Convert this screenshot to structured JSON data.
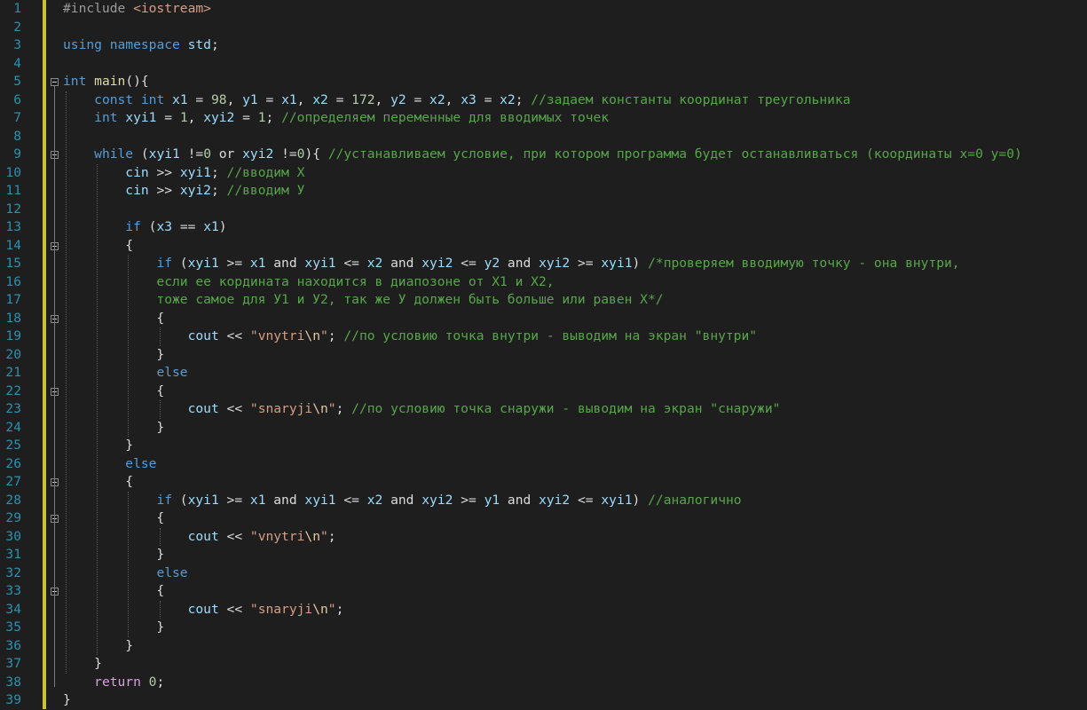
{
  "lines": [
    [
      [
        "p",
        "#include "
      ],
      [
        "s",
        "<iostream>"
      ]
    ],
    [],
    [
      [
        "k",
        "using"
      ],
      [
        "t",
        " "
      ],
      [
        "k",
        "namespace"
      ],
      [
        "t",
        " "
      ],
      [
        "v",
        "std"
      ],
      [
        "t",
        ";"
      ]
    ],
    [],
    [
      [
        "ty",
        "int"
      ],
      [
        "t",
        " "
      ],
      [
        "fn",
        "main"
      ],
      [
        "t",
        "(){"
      ]
    ],
    [
      [
        "t",
        "    "
      ],
      [
        "k",
        "const"
      ],
      [
        "t",
        " "
      ],
      [
        "ty",
        "int"
      ],
      [
        "t",
        " "
      ],
      [
        "v",
        "x1"
      ],
      [
        "t",
        " = "
      ],
      [
        "n",
        "98"
      ],
      [
        "t",
        ", "
      ],
      [
        "v",
        "y1"
      ],
      [
        "t",
        " = "
      ],
      [
        "v",
        "x1"
      ],
      [
        "t",
        ", "
      ],
      [
        "v",
        "x2"
      ],
      [
        "t",
        " = "
      ],
      [
        "n",
        "172"
      ],
      [
        "t",
        ", "
      ],
      [
        "v",
        "y2"
      ],
      [
        "t",
        " = "
      ],
      [
        "v",
        "x2"
      ],
      [
        "t",
        ", "
      ],
      [
        "v",
        "x3"
      ],
      [
        "t",
        " = "
      ],
      [
        "v",
        "x2"
      ],
      [
        "t",
        "; "
      ],
      [
        "c",
        "//задаем константы координат треугольника"
      ]
    ],
    [
      [
        "t",
        "    "
      ],
      [
        "ty",
        "int"
      ],
      [
        "t",
        " "
      ],
      [
        "v",
        "xyi1"
      ],
      [
        "t",
        " = "
      ],
      [
        "n",
        "1"
      ],
      [
        "t",
        ", "
      ],
      [
        "v",
        "xyi2"
      ],
      [
        "t",
        " = "
      ],
      [
        "n",
        "1"
      ],
      [
        "t",
        "; "
      ],
      [
        "c",
        "//определяем переменные для вводимых точек"
      ]
    ],
    [],
    [
      [
        "t",
        "    "
      ],
      [
        "k",
        "while"
      ],
      [
        "t",
        " ("
      ],
      [
        "v",
        "xyi1"
      ],
      [
        "t",
        " !="
      ],
      [
        "n",
        "0"
      ],
      [
        "t",
        " or "
      ],
      [
        "v",
        "xyi2"
      ],
      [
        "t",
        " !="
      ],
      [
        "n",
        "0"
      ],
      [
        "t",
        "){ "
      ],
      [
        "c",
        "//устанавливаем условие, при котором программа будет останавливаться (координаты x=0 y=0)"
      ]
    ],
    [
      [
        "t",
        "        "
      ],
      [
        "v",
        "cin"
      ],
      [
        "t",
        " >> "
      ],
      [
        "v",
        "xyi1"
      ],
      [
        "t",
        "; "
      ],
      [
        "c",
        "//вводим Х"
      ]
    ],
    [
      [
        "t",
        "        "
      ],
      [
        "v",
        "cin"
      ],
      [
        "t",
        " >> "
      ],
      [
        "v",
        "xyi2"
      ],
      [
        "t",
        "; "
      ],
      [
        "c",
        "//вводим У"
      ]
    ],
    [],
    [
      [
        "t",
        "        "
      ],
      [
        "k",
        "if"
      ],
      [
        "t",
        " ("
      ],
      [
        "v",
        "x3"
      ],
      [
        "t",
        " == "
      ],
      [
        "v",
        "x1"
      ],
      [
        "t",
        ")"
      ]
    ],
    [
      [
        "t",
        "        {"
      ]
    ],
    [
      [
        "t",
        "            "
      ],
      [
        "k",
        "if"
      ],
      [
        "t",
        " ("
      ],
      [
        "v",
        "xyi1"
      ],
      [
        "t",
        " >= "
      ],
      [
        "v",
        "x1"
      ],
      [
        "t",
        " and "
      ],
      [
        "v",
        "xyi1"
      ],
      [
        "t",
        " <= "
      ],
      [
        "v",
        "x2"
      ],
      [
        "t",
        " and "
      ],
      [
        "v",
        "xyi2"
      ],
      [
        "t",
        " <= "
      ],
      [
        "v",
        "y2"
      ],
      [
        "t",
        " and "
      ],
      [
        "v",
        "xyi2"
      ],
      [
        "t",
        " >= "
      ],
      [
        "v",
        "xyi1"
      ],
      [
        "t",
        ") "
      ],
      [
        "c",
        "/*проверяем вводимую точку - она внутри,"
      ]
    ],
    [
      [
        "c",
        "            если ее кордината находится в диапозоне от Х1 и Х2,"
      ]
    ],
    [
      [
        "c",
        "            тоже самое для У1 и У2, так же У должен быть больше или равен Х*/"
      ]
    ],
    [
      [
        "t",
        "            {"
      ]
    ],
    [
      [
        "t",
        "                "
      ],
      [
        "v",
        "cout"
      ],
      [
        "t",
        " << "
      ],
      [
        "s",
        "\"vnytri"
      ],
      [
        "esc",
        "\\n"
      ],
      [
        "s",
        "\""
      ],
      [
        "t",
        "; "
      ],
      [
        "c",
        "//по условию точка внутри - выводим на экран \"внутри\""
      ]
    ],
    [
      [
        "t",
        "            }"
      ]
    ],
    [
      [
        "t",
        "            "
      ],
      [
        "k",
        "else"
      ]
    ],
    [
      [
        "t",
        "            {"
      ]
    ],
    [
      [
        "t",
        "                "
      ],
      [
        "v",
        "cout"
      ],
      [
        "t",
        " << "
      ],
      [
        "s",
        "\"snaryji"
      ],
      [
        "esc",
        "\\n"
      ],
      [
        "s",
        "\""
      ],
      [
        "t",
        "; "
      ],
      [
        "c",
        "//по условию точка снаружи - выводим на экран \"снаружи\""
      ]
    ],
    [
      [
        "t",
        "            }"
      ]
    ],
    [
      [
        "t",
        "        }"
      ]
    ],
    [
      [
        "t",
        "        "
      ],
      [
        "k",
        "else"
      ]
    ],
    [
      [
        "t",
        "        {"
      ]
    ],
    [
      [
        "t",
        "            "
      ],
      [
        "k",
        "if"
      ],
      [
        "t",
        " ("
      ],
      [
        "v",
        "xyi1"
      ],
      [
        "t",
        " >= "
      ],
      [
        "v",
        "x1"
      ],
      [
        "t",
        " and "
      ],
      [
        "v",
        "xyi1"
      ],
      [
        "t",
        " <= "
      ],
      [
        "v",
        "x2"
      ],
      [
        "t",
        " and "
      ],
      [
        "v",
        "xyi2"
      ],
      [
        "t",
        " >= "
      ],
      [
        "v",
        "y1"
      ],
      [
        "t",
        " and "
      ],
      [
        "v",
        "xyi2"
      ],
      [
        "t",
        " <= "
      ],
      [
        "v",
        "xyi1"
      ],
      [
        "t",
        ") "
      ],
      [
        "c",
        "//аналогично"
      ]
    ],
    [
      [
        "t",
        "            {"
      ]
    ],
    [
      [
        "t",
        "                "
      ],
      [
        "v",
        "cout"
      ],
      [
        "t",
        " << "
      ],
      [
        "s",
        "\"vnytri"
      ],
      [
        "esc",
        "\\n"
      ],
      [
        "s",
        "\""
      ],
      [
        "t",
        ";"
      ]
    ],
    [
      [
        "t",
        "            }"
      ]
    ],
    [
      [
        "t",
        "            "
      ],
      [
        "k",
        "else"
      ]
    ],
    [
      [
        "t",
        "            {"
      ]
    ],
    [
      [
        "t",
        "                "
      ],
      [
        "v",
        "cout"
      ],
      [
        "t",
        " << "
      ],
      [
        "s",
        "\"snaryji"
      ],
      [
        "esc",
        "\\n"
      ],
      [
        "s",
        "\""
      ],
      [
        "t",
        ";"
      ]
    ],
    [
      [
        "t",
        "            }"
      ]
    ],
    [
      [
        "t",
        "        }"
      ]
    ],
    [
      [
        "t",
        "    }"
      ]
    ],
    [
      [
        "t",
        "    "
      ],
      [
        "kw",
        "return"
      ],
      [
        "t",
        " "
      ],
      [
        "n",
        "0"
      ],
      [
        "t",
        ";"
      ]
    ],
    [
      [
        "t",
        "}"
      ]
    ]
  ],
  "fold_lines": [
    5,
    9,
    14,
    18,
    22,
    27,
    29,
    33
  ]
}
